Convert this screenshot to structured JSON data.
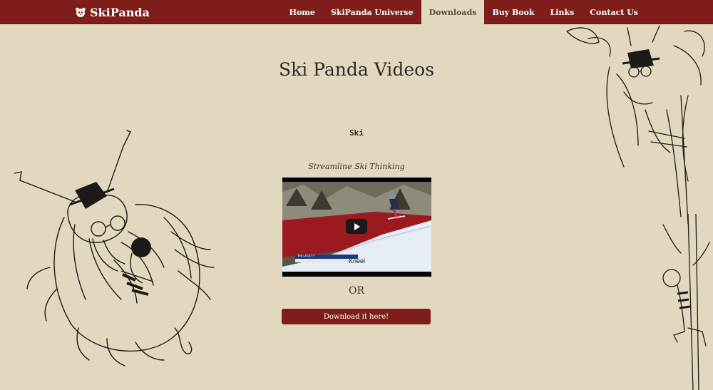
{
  "brand": {
    "name": "SkiPanda",
    "icon": "panda-logo-icon"
  },
  "nav": {
    "items": [
      {
        "label": "Home",
        "active": false
      },
      {
        "label": "SkiPanda Universe",
        "active": false
      },
      {
        "label": "Downloads",
        "active": true
      },
      {
        "label": "Buy Book",
        "active": false
      },
      {
        "label": "Links",
        "active": false
      },
      {
        "label": "Contact Us",
        "active": false
      }
    ]
  },
  "page": {
    "title": "Ski Panda Videos",
    "section_label": "Ski",
    "video_caption": "Streamline Ski Thinking",
    "video_overlay": {
      "name_bar": "Ted LIGETY",
      "word": "Kneel",
      "play_icon": "play-icon"
    },
    "or_text": "OR",
    "download_button": "Download it here!"
  },
  "colors": {
    "navbar": "#7e1d19",
    "background": "#e2d8c0",
    "button": "#7e1d19",
    "active_tab": "#e2d8c0"
  }
}
